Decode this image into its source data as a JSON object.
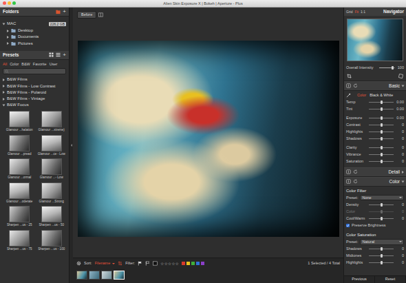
{
  "window": {
    "title": "Alien Skin Exposure X | Bokeh | Aperture - Plus"
  },
  "folders": {
    "title": "Folders",
    "add": "+",
    "drive": {
      "name": "MAC",
      "badge": "226.2 GB",
      "expanded": true
    },
    "items": [
      {
        "name": "Desktop",
        "expanded": false
      },
      {
        "name": "Documents",
        "expanded": false
      },
      {
        "name": "Pictures",
        "expanded": false
      }
    ]
  },
  "presets": {
    "title": "Presets",
    "add": "+",
    "tabs": [
      {
        "label": "All",
        "selected": true
      },
      {
        "label": "Color",
        "selected": false
      },
      {
        "label": "B&W",
        "selected": false
      },
      {
        "label": "Favorite",
        "selected": false
      },
      {
        "label": "User",
        "selected": false
      }
    ],
    "groups": [
      {
        "name": "B&W Films",
        "expanded": false
      },
      {
        "name": "B&W Films - Low Contrast",
        "expanded": false
      },
      {
        "name": "B&W Films - Polaroid",
        "expanded": false
      },
      {
        "name": "B&W Films - Vintage",
        "expanded": false
      },
      {
        "name": "B&W Focus",
        "expanded": true
      }
    ],
    "thumbnails": [
      {
        "label": "Glamour ...halation"
      },
      {
        "label": "Glamour ...xtreme)"
      },
      {
        "label": "Glamour ...pread"
      },
      {
        "label": "Glamour ...ce - Low"
      },
      {
        "label": "Glamour ...ormal"
      },
      {
        "label": "Glamour ...- Low"
      },
      {
        "label": "Glamour ...oderate"
      },
      {
        "label": "Glamour ...Strong"
      },
      {
        "label": "Sharpen ...us - 25"
      },
      {
        "label": "Sharpen ...us - 50"
      },
      {
        "label": "Sharpen ...us - 75"
      },
      {
        "label": "Sharpen ...us - 100"
      }
    ]
  },
  "viewer": {
    "before": "Before"
  },
  "bottom_bar": {
    "sort_label": "Sort:",
    "sort_value": "Filename",
    "filter_label": "Filter:",
    "star_glyph": "☆",
    "star_count": 5,
    "stars": 0,
    "color_labels": [
      {
        "color": "#d93a2b",
        "selected": false
      },
      {
        "color": "#e8c21e",
        "selected": false
      },
      {
        "color": "#3fae3a",
        "selected": false
      },
      {
        "color": "#2f6fd8",
        "selected": false
      },
      {
        "color": "#8a3fc8",
        "selected": false
      }
    ],
    "status": "1 Selected / 4 Total"
  },
  "filmstrip": [
    {
      "selected": false
    },
    {
      "selected": false
    },
    {
      "selected": false
    },
    {
      "selected": true
    }
  ],
  "navigator": {
    "title": "Navigator",
    "zoom": [
      {
        "label": "Grid",
        "selected": false
      },
      {
        "label": "Fit",
        "selected": true
      },
      {
        "label": "1:1",
        "selected": false
      }
    ]
  },
  "intensity": {
    "label": "Overall Intensity",
    "value": "100",
    "level": 0.85
  },
  "basic": {
    "title": "Basic",
    "expanded": true,
    "modes": [
      {
        "label": "Color",
        "selected": true
      },
      {
        "label": "Black & White",
        "selected": false
      }
    ],
    "groups": [
      [
        {
          "label": "Temp",
          "value": "0.00",
          "level": 0.5
        },
        {
          "label": "Tint",
          "value": "0.00",
          "level": 0.5
        }
      ],
      [
        {
          "label": "Exposure",
          "value": "0.00",
          "level": 0.5
        },
        {
          "label": "Contrast",
          "value": "0",
          "level": 0.5
        },
        {
          "label": "Highlights",
          "value": "0",
          "level": 0.5
        },
        {
          "label": "Shadows",
          "value": "0",
          "level": 0.5
        }
      ],
      [
        {
          "label": "Clarity",
          "value": "0",
          "level": 0.5
        },
        {
          "label": "Vibrance",
          "value": "0",
          "level": 0.5
        },
        {
          "label": "Saturation",
          "value": "0",
          "level": 0.5
        }
      ]
    ]
  },
  "detail": {
    "title": "Detail",
    "expanded": false
  },
  "color": {
    "title": "Color",
    "expanded": true,
    "subsections": [
      {
        "title": "Color Filter",
        "preset_label": "Preset:",
        "preset": "None",
        "rows": [
          {
            "kind": "slider",
            "label": "Density",
            "value": "0",
            "level": 0.5,
            "disabled": false
          },
          {
            "kind": "slider",
            "label": "Color",
            "value": "0",
            "level": 0.5,
            "disabled": true
          },
          {
            "kind": "slider",
            "label": "Cool/Warm",
            "value": "0",
            "level": 0.5,
            "disabled": false
          },
          {
            "kind": "checkbox",
            "label": "Preserve Brightness",
            "checked": true
          }
        ]
      },
      {
        "title": "Color Saturation",
        "preset_label": "Preset:",
        "preset": "Natural",
        "rows": [
          {
            "kind": "slider",
            "label": "Shadows",
            "value": "0",
            "level": 0.5,
            "disabled": false
          },
          {
            "kind": "slider",
            "label": "Midtones",
            "value": "0",
            "level": 0.5,
            "disabled": false
          },
          {
            "kind": "slider",
            "label": "Highlights",
            "value": "0",
            "level": 0.5,
            "disabled": false
          }
        ]
      }
    ]
  },
  "footer": {
    "buttons": [
      "Previous",
      "Reset"
    ]
  }
}
